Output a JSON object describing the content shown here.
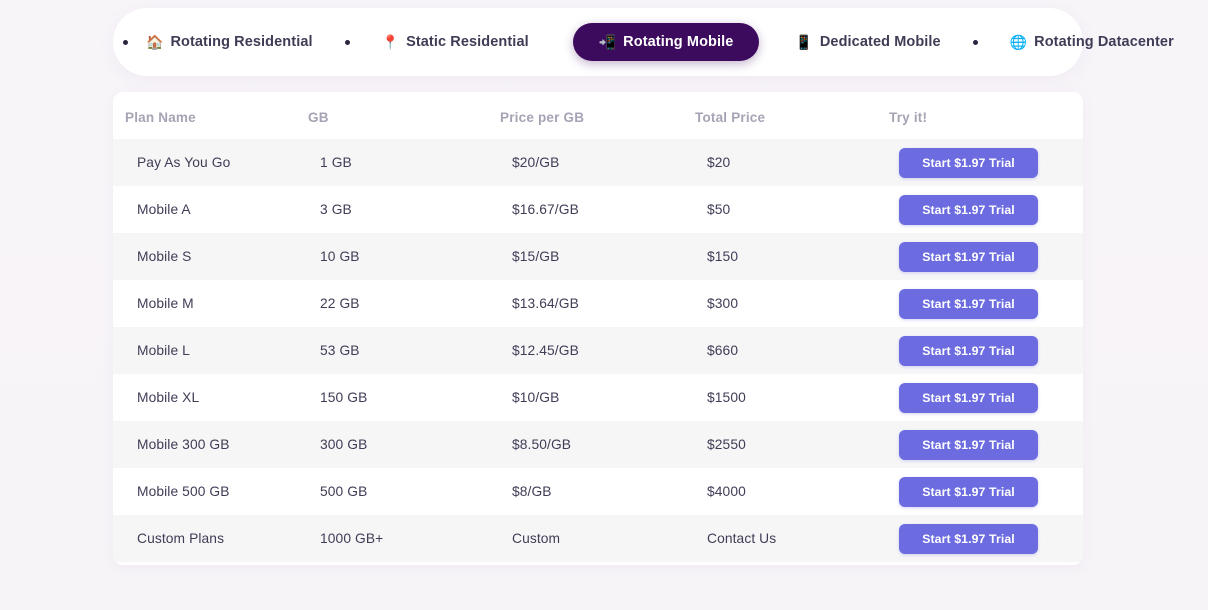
{
  "tabs": [
    {
      "icon": "house-icon",
      "glyph": "🏠",
      "label": "Rotating Residential",
      "active": false
    },
    {
      "icon": "pushpin-icon",
      "glyph": "📍",
      "label": "Static Residential",
      "active": false
    },
    {
      "icon": "rotating-mobile-icon",
      "glyph": "📲",
      "label": "Rotating Mobile",
      "active": true
    },
    {
      "icon": "mobile-phone-icon",
      "glyph": "📱",
      "label": "Dedicated Mobile",
      "active": false
    },
    {
      "icon": "globe-icon",
      "glyph": "🌐",
      "label": "Rotating Datacenter",
      "active": false
    }
  ],
  "table": {
    "headers": [
      "Plan Name",
      "GB",
      "Price per GB",
      "Total Price",
      "Try it!"
    ],
    "rows": [
      {
        "plan": "Pay As You Go",
        "gb": "1 GB",
        "price_per_gb": "$20/GB",
        "total": "$20",
        "cta": "Start $1.97 Trial"
      },
      {
        "plan": "Mobile A",
        "gb": "3 GB",
        "price_per_gb": "$16.67/GB",
        "total": "$50",
        "cta": "Start $1.97 Trial"
      },
      {
        "plan": "Mobile S",
        "gb": "10 GB",
        "price_per_gb": "$15/GB",
        "total": "$150",
        "cta": "Start $1.97 Trial"
      },
      {
        "plan": "Mobile M",
        "gb": "22 GB",
        "price_per_gb": "$13.64/GB",
        "total": "$300",
        "cta": "Start $1.97 Trial"
      },
      {
        "plan": "Mobile L",
        "gb": "53 GB",
        "price_per_gb": "$12.45/GB",
        "total": "$660",
        "cta": "Start $1.97 Trial"
      },
      {
        "plan": "Mobile XL",
        "gb": "150 GB",
        "price_per_gb": "$10/GB",
        "total": "$1500",
        "cta": "Start $1.97 Trial"
      },
      {
        "plan": "Mobile 300 GB",
        "gb": "300 GB",
        "price_per_gb": "$8.50/GB",
        "total": "$2550",
        "cta": "Start $1.97 Trial"
      },
      {
        "plan": "Mobile 500 GB",
        "gb": "500 GB",
        "price_per_gb": "$8/GB",
        "total": "$4000",
        "cta": "Start $1.97 Trial"
      },
      {
        "plan": "Custom Plans",
        "gb": "1000 GB+",
        "price_per_gb": "Custom",
        "total": "Contact Us",
        "cta": "Start $1.97 Trial"
      }
    ]
  },
  "colors": {
    "page_background": "#f7f5f8",
    "card_background": "#ffffff",
    "active_tab": "#3d0b5e",
    "cta_button": "#6c6ce0",
    "text_primary": "#3f3d56",
    "text_muted": "#a7a3b4",
    "row_stripe": "#f7f6f7"
  }
}
